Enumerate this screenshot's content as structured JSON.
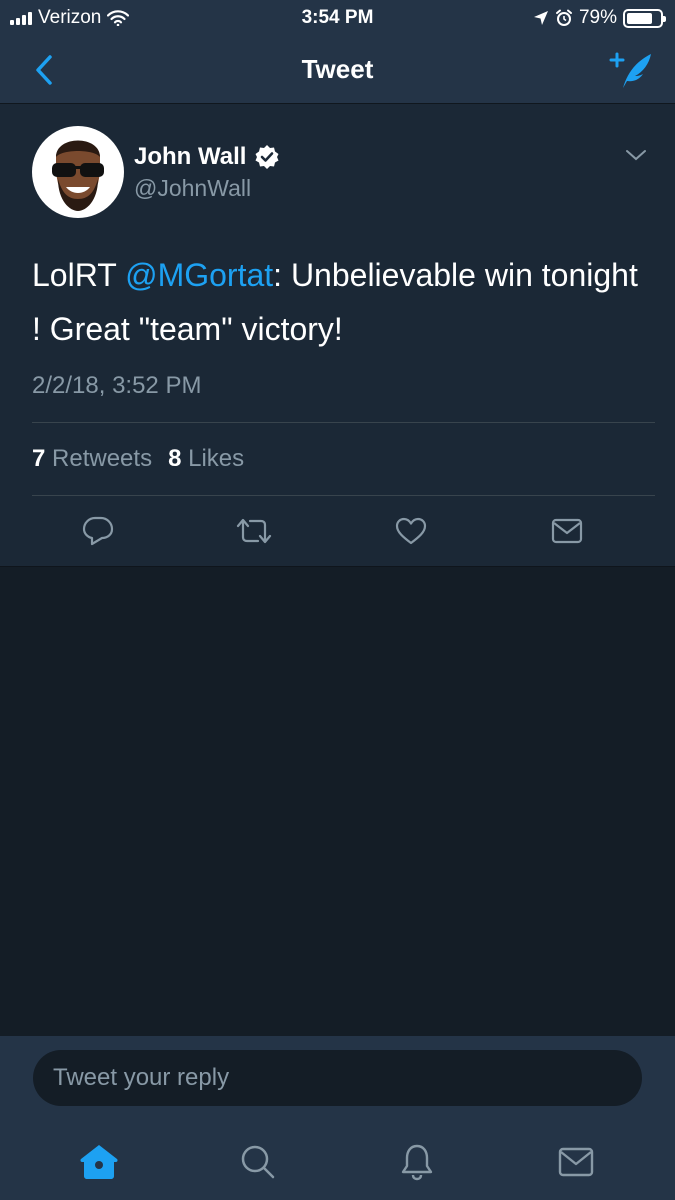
{
  "status_bar": {
    "carrier": "Verizon",
    "time": "3:54 PM",
    "battery_percent": "79%",
    "battery_level": 0.79
  },
  "nav": {
    "title": "Tweet",
    "back_icon": "chevron-left-icon",
    "compose_icon": "compose-tweet-icon"
  },
  "tweet": {
    "author_name": "John Wall",
    "author_handle": "@JohnWall",
    "text_prefix": "LolRT ",
    "mention": "@MGortat",
    "text_suffix": ": Unbelievable win tonight ! Great \"team\" victory!",
    "timestamp": "2/2/18, 3:52 PM",
    "retweet_count": "7",
    "retweet_label": "Retweets",
    "like_count": "8",
    "like_label": "Likes"
  },
  "reply": {
    "placeholder": "Tweet your reply"
  },
  "tabbar": {
    "items": [
      "home-icon",
      "search-icon",
      "notifications-icon",
      "messages-icon"
    ],
    "active": "home-icon"
  },
  "colors": {
    "accent": "#1da1f2",
    "background": "#141d26",
    "card": "#1b2836",
    "bar": "#243447",
    "muted_text": "#8899a6"
  }
}
